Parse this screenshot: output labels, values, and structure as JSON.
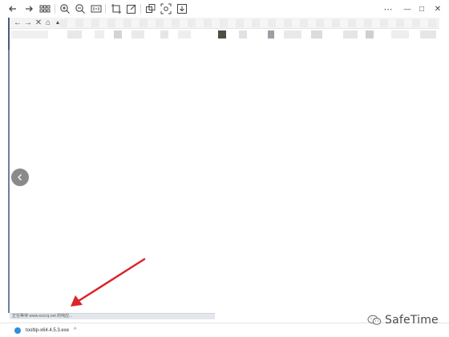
{
  "toolbar": {
    "icons": [
      "back-icon",
      "forward-icon",
      "grid-icon",
      "zoom-in-icon",
      "zoom-out-icon",
      "fit-icon",
      "crop-icon",
      "edit-icon",
      "copy-icon",
      "scan-icon",
      "download-icon"
    ],
    "window_controls": {
      "more": "⋯",
      "minimize": "—",
      "maximize": "□",
      "close": "✕"
    }
  },
  "inner_browser": {
    "nav": {
      "back": "←",
      "forward": "→",
      "stop": "✕",
      "home": "⌂",
      "secure": "▲"
    }
  },
  "status_bar": {
    "text": "正在等待 www.ezccq.net 的响应..."
  },
  "download_bar": {
    "filename": "tooltip-x64.4.5.3.exe",
    "chevron": "^"
  },
  "watermark": {
    "text": "SafeTime"
  },
  "colors": {
    "arrow": "#d9262b",
    "left_rule": "#6b7fa0",
    "status_bar": "#e3e7ec",
    "download_icon": "#2f8fd8"
  }
}
